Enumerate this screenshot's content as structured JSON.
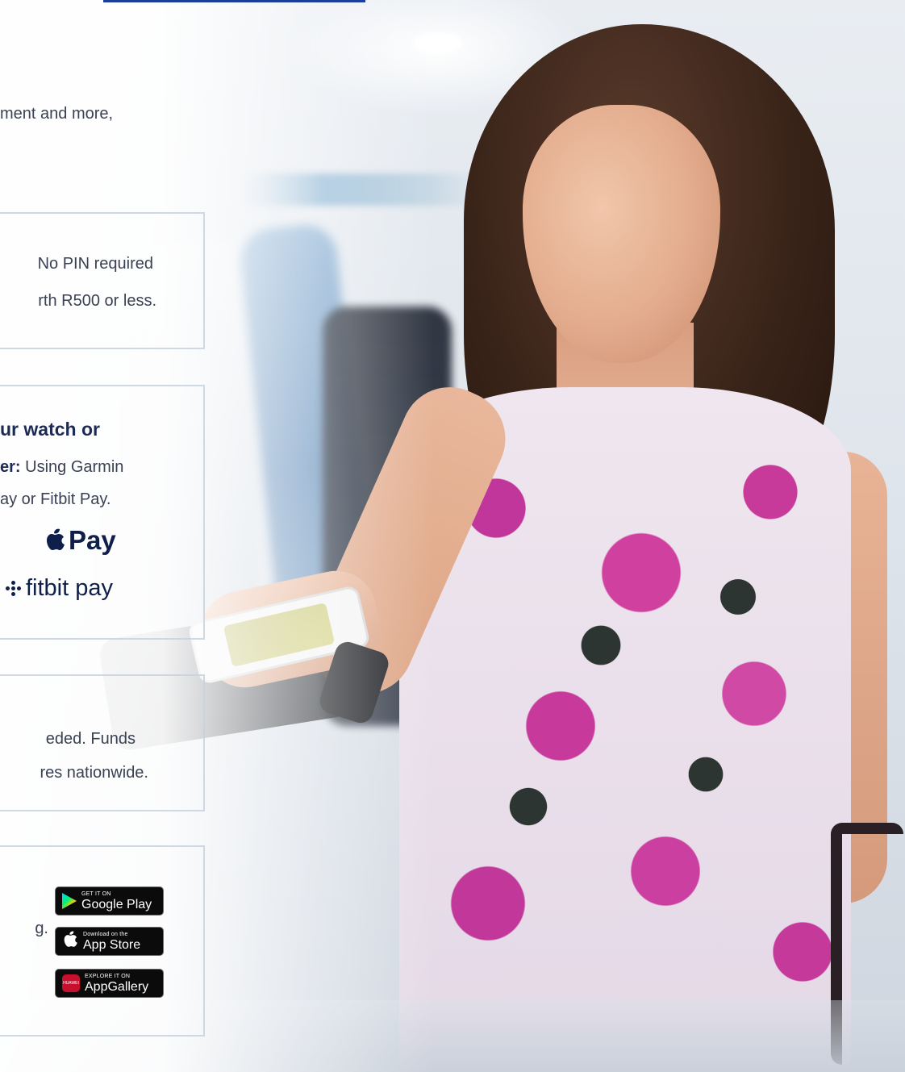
{
  "intro": {
    "text": "ment and more,"
  },
  "contactless": {
    "line1": "No PIN required",
    "line2": "rth R500 or less."
  },
  "wearable": {
    "heading": "ur watch or",
    "line2_bold": "er:",
    "line2_rest": " Using Garmin",
    "line3": "ay or Fitbit Pay.",
    "apple_pay_label": "Pay",
    "fitbit_pay_label": "fitbit pay"
  },
  "cash": {
    "line1": "eded. Funds",
    "line2": "res nationwide."
  },
  "app": {
    "line1": "g.",
    "badges": [
      {
        "small": "GET IT ON",
        "big": "Google Play",
        "icon": "google-play-icon"
      },
      {
        "small": "Download on the",
        "big": "App Store",
        "icon": "apple-icon"
      },
      {
        "small": "EXPLORE IT ON",
        "big": "AppGallery",
        "icon": "huawei-icon",
        "brand": "HUAWEI"
      }
    ]
  },
  "colors": {
    "accent_blue": "#1b3e9c",
    "navy_text": "#1d2a55",
    "body_text": "#3a4152",
    "box_border": "#c8d2de"
  }
}
